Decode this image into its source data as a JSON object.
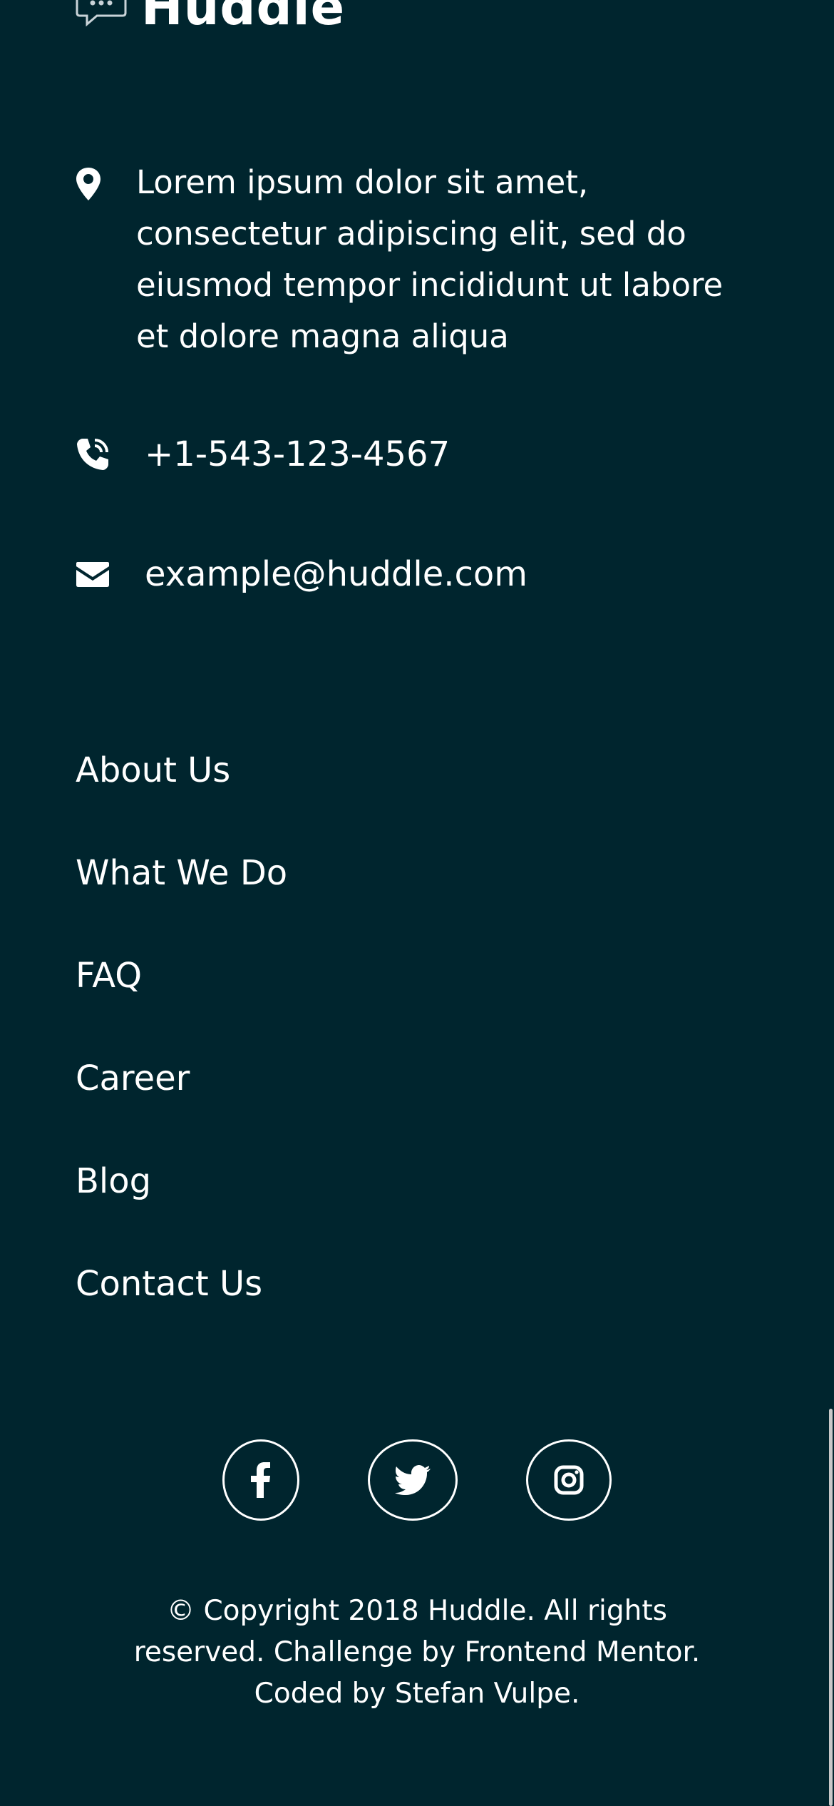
{
  "brand": {
    "name": "Huddle",
    "logo_icon": "chat-bubble-icon"
  },
  "contact": {
    "address": "Lorem ipsum dolor sit amet, consectetur adipiscing elit, sed do eiusmod tempor incididunt ut labore et dolore magna aliqua",
    "address_icon": "location-pin-icon",
    "phone": "+1-543-123-4567",
    "phone_icon": "phone-icon",
    "email": "example@huddle.com",
    "email_icon": "envelope-icon"
  },
  "nav": {
    "items": [
      {
        "label": "About Us"
      },
      {
        "label": "What We Do"
      },
      {
        "label": "FAQ"
      },
      {
        "label": "Career"
      },
      {
        "label": "Blog"
      },
      {
        "label": "Contact Us"
      }
    ]
  },
  "social": {
    "items": [
      {
        "name": "facebook",
        "icon": "facebook-icon"
      },
      {
        "name": "twitter",
        "icon": "twitter-icon"
      },
      {
        "name": "instagram",
        "icon": "instagram-icon"
      }
    ]
  },
  "footer": {
    "copyright": "© Copyright 2018 Huddle. All rights reserved. Challenge by Frontend Mentor. Coded by Stefan Vulpe."
  },
  "colors": {
    "background": "#00252e",
    "text": "#ffffff"
  }
}
